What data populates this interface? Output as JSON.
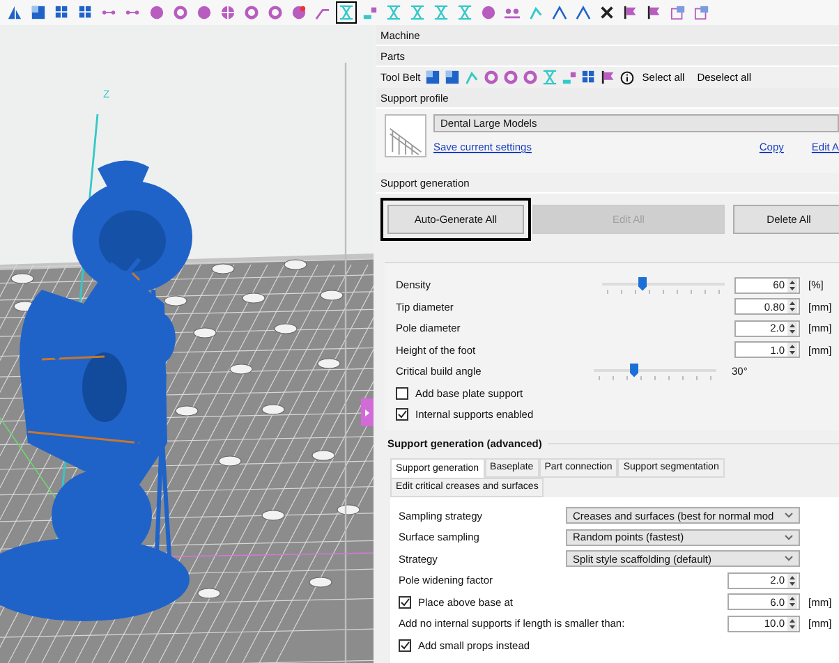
{
  "toolbar": {
    "icons": [
      {
        "selected": false
      },
      {
        "selected": false
      },
      {
        "selected": false
      },
      {
        "selected": false
      },
      {
        "selected": false
      },
      {
        "selected": false
      },
      {
        "selected": false
      },
      {
        "selected": false
      },
      {
        "selected": false
      },
      {
        "selected": false
      },
      {
        "selected": false
      },
      {
        "selected": false
      },
      {
        "selected": false
      },
      {
        "selected": false
      },
      {
        "selected": true
      },
      {
        "selected": false
      },
      {
        "selected": false
      },
      {
        "selected": false
      },
      {
        "selected": false
      },
      {
        "selected": false
      },
      {
        "selected": false
      },
      {
        "selected": false
      },
      {
        "selected": false
      },
      {
        "selected": false
      },
      {
        "selected": false
      },
      {
        "selected": false
      },
      {
        "selected": false
      },
      {
        "selected": false
      },
      {
        "selected": false
      },
      {
        "selected": false
      }
    ]
  },
  "viewport": {
    "axis_label": "Z"
  },
  "panel": {
    "machine": "Machine",
    "parts": "Parts",
    "tool_belt": {
      "label": "Tool Belt",
      "actions": [
        "Select all",
        "Deselect all"
      ]
    },
    "support_profile": {
      "title": "Support profile",
      "profile": "Dental Large Models",
      "save_link": "Save current settings",
      "links": [
        "Copy",
        "Edit A"
      ]
    },
    "support_generation": {
      "title": "Support generation",
      "buttons": [
        {
          "label": "Auto-Generate All",
          "disabled": false,
          "selected": true
        },
        {
          "label": "Edit All",
          "disabled": true,
          "selected": false
        },
        {
          "label": "Delete All",
          "disabled": false,
          "selected": false
        }
      ],
      "settings": [
        {
          "kind": "slider",
          "label": "Density",
          "level": 0.33,
          "value": "60",
          "unit": "[%]"
        },
        {
          "kind": "number",
          "label": "Tip diameter",
          "value": "0.80",
          "unit": "[mm]"
        },
        {
          "kind": "number",
          "label": "Pole diameter",
          "value": "2.0",
          "unit": "[mm]"
        },
        {
          "kind": "number",
          "label": "Height of the foot",
          "value": "1.0",
          "unit": "[mm]"
        },
        {
          "kind": "slider",
          "label": "Critical build angle",
          "level": 0.33,
          "reading": "30°"
        },
        {
          "kind": "checkbox",
          "label": "Add base plate support",
          "checked": false
        },
        {
          "kind": "checkbox",
          "label": "Internal supports enabled",
          "checked": true
        }
      ]
    },
    "advanced": {
      "title": "Support generation (advanced)",
      "tabs": [
        {
          "label": "Support generation",
          "selected": true
        },
        {
          "label": "Baseplate",
          "selected": false
        },
        {
          "label": "Part connection",
          "selected": false
        },
        {
          "label": "Support segmentation",
          "selected": false
        },
        {
          "label": "Edit critical creases and surfaces",
          "selected": false
        }
      ],
      "settings": [
        {
          "kind": "select",
          "label": "Sampling strategy",
          "value": "Creases and surfaces (best for normal mod"
        },
        {
          "kind": "select",
          "label": "Surface sampling",
          "value": "Random points (fastest)"
        },
        {
          "kind": "select",
          "label": "Strategy",
          "value": "Split style scaffolding (default)"
        },
        {
          "kind": "number",
          "label": "Pole widening factor",
          "value": "2.0"
        },
        {
          "kind": "checknumber",
          "label": "Place above base at",
          "checked": true,
          "value": "6.0",
          "unit": "[mm]"
        },
        {
          "kind": "number",
          "label": "Add no internal supports if length is smaller than:",
          "value": "10.0",
          "unit": "[mm]"
        },
        {
          "kind": "checkbox",
          "label": "Add small props instead",
          "checked": true
        }
      ]
    }
  }
}
